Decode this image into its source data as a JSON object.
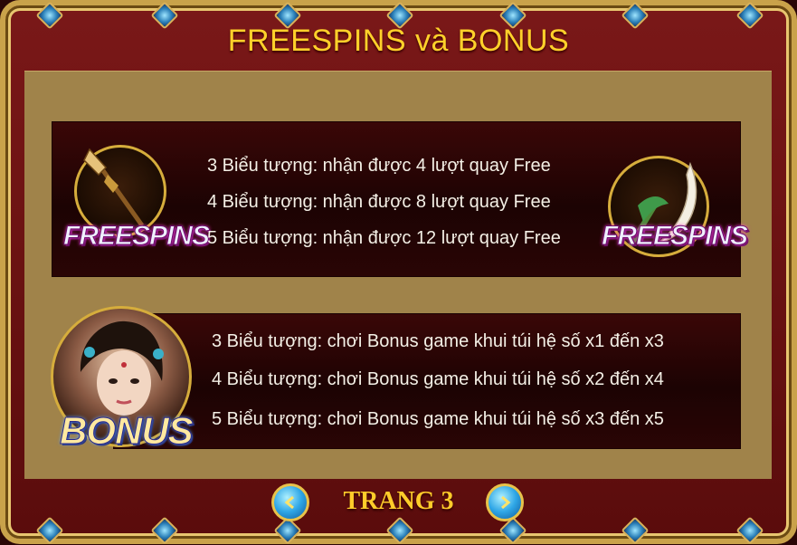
{
  "title": "FREESPINS và BONUS",
  "freespins": {
    "badge_label": "FREESPINS",
    "lines": [
      "3 Biểu tượng: nhận được 4 lượt quay Free",
      "4 Biểu tượng: nhận được 8 lượt quay Free",
      "5 Biểu tượng: nhận được 12 lượt quay Free"
    ]
  },
  "bonus": {
    "badge_label": "BONUS",
    "lines": [
      "3 Biểu tượng: chơi Bonus game khui túi hệ số x1 đến x3",
      "4 Biểu tượng: chơi Bonus game khui túi hệ số x2 đến x4",
      "5 Biểu tượng: chơi Bonus game khui túi hệ số x3 đến x5"
    ]
  },
  "pager": {
    "label": "TRANG 3"
  },
  "colors": {
    "title": "#ffd12a",
    "frame_gold": "#c9a24a",
    "board": "#a0834a",
    "nav_blue": "#2ea6e6"
  }
}
